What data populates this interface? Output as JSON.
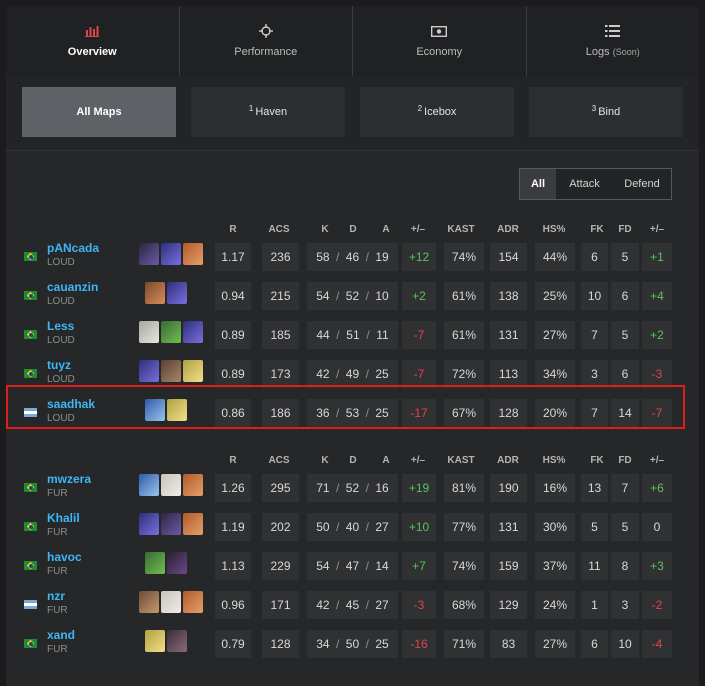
{
  "tabs": [
    {
      "label": "Overview",
      "icon": "bar-chart-icon",
      "active": true
    },
    {
      "label": "Performance",
      "icon": "crosshair-icon",
      "active": false
    },
    {
      "label": "Economy",
      "icon": "money-icon",
      "active": false
    },
    {
      "label": "Logs",
      "suffix": "(Soon)",
      "icon": "list-icon",
      "active": false
    }
  ],
  "maps": [
    {
      "num": "",
      "label": "All Maps",
      "active": true
    },
    {
      "num": "1",
      "label": "Haven"
    },
    {
      "num": "2",
      "label": "Icebox"
    },
    {
      "num": "3",
      "label": "Bind"
    }
  ],
  "side_filter": {
    "all": "All",
    "attack": "Attack",
    "defend": "Defend",
    "selected": "All"
  },
  "headers": {
    "r": "R",
    "acs": "ACS",
    "k": "K",
    "d": "D",
    "a": "A",
    "pm": "+/–",
    "kast": "KAST",
    "adr": "ADR",
    "hs": "HS%",
    "fk": "FK",
    "fd": "FD",
    "fkpm": "+/–"
  },
  "colors": {
    "accent_tab_icon": "#e0454b",
    "positive": "#5dc15d",
    "negative": "#e0454b",
    "player_link": "#3fb6f5",
    "highlight": "#e21b1b"
  },
  "teams": [
    {
      "players": [
        {
          "name": "pANcada",
          "team": "LOUD",
          "flag": "br",
          "agents": [
            "omen",
            "astra",
            "kayo"
          ],
          "r": "1.17",
          "acs": "236",
          "k": "58",
          "d": "46",
          "a": "19",
          "pm": "+12",
          "kast": "74%",
          "adr": "154",
          "hs": "44%",
          "fk": "6",
          "fd": "5",
          "fkpm": "+1"
        },
        {
          "name": "cauanzin",
          "team": "LOUD",
          "flag": "br",
          "agents": [
            "skye",
            "astra"
          ],
          "r": "0.94",
          "acs": "215",
          "k": "54",
          "d": "52",
          "a": "10",
          "pm": "+2",
          "kast": "61%",
          "adr": "138",
          "hs": "25%",
          "fk": "10",
          "fd": "6",
          "fkpm": "+4"
        },
        {
          "name": "Less",
          "team": "LOUD",
          "flag": "br",
          "agents": [
            "sage",
            "viper",
            "astra"
          ],
          "r": "0.89",
          "acs": "185",
          "k": "44",
          "d": "51",
          "a": "11",
          "pm": "-7",
          "kast": "61%",
          "adr": "131",
          "hs": "27%",
          "fk": "7",
          "fd": "5",
          "fkpm": "+2"
        },
        {
          "name": "tuyz",
          "team": "LOUD",
          "flag": "br",
          "agents": [
            "astra",
            "brimstone",
            "neon"
          ],
          "r": "0.89",
          "acs": "173",
          "k": "42",
          "d": "49",
          "a": "25",
          "pm": "-7",
          "kast": "72%",
          "adr": "113",
          "hs": "34%",
          "fk": "3",
          "fd": "6",
          "fkpm": "-3"
        },
        {
          "name": "saadhak",
          "team": "LOUD",
          "flag": "ar",
          "agents": [
            "jett",
            "neon"
          ],
          "r": "0.86",
          "acs": "186",
          "k": "36",
          "d": "53",
          "a": "25",
          "pm": "-17",
          "kast": "67%",
          "adr": "128",
          "hs": "20%",
          "fk": "7",
          "fd": "14",
          "fkpm": "-7"
        }
      ]
    },
    {
      "players": [
        {
          "name": "mwzera",
          "team": "FUR",
          "flag": "br",
          "agents": [
            "jett",
            "chamber",
            "kayo"
          ],
          "r": "1.26",
          "acs": "295",
          "k": "71",
          "d": "52",
          "a": "16",
          "pm": "+19",
          "kast": "81%",
          "adr": "190",
          "hs": "16%",
          "fk": "13",
          "fd": "7",
          "fkpm": "+6"
        },
        {
          "name": "Khalil",
          "team": "FUR",
          "flag": "br",
          "agents": [
            "astra",
            "omen",
            "kayo"
          ],
          "r": "1.19",
          "acs": "202",
          "k": "50",
          "d": "40",
          "a": "27",
          "pm": "+10",
          "kast": "77%",
          "adr": "131",
          "hs": "30%",
          "fk": "5",
          "fd": "5",
          "fkpm": "0"
        },
        {
          "name": "havoc",
          "team": "FUR",
          "flag": "br",
          "agents": [
            "viper",
            "reyna"
          ],
          "r": "1.13",
          "acs": "229",
          "k": "54",
          "d": "47",
          "a": "14",
          "pm": "+7",
          "kast": "74%",
          "adr": "159",
          "hs": "37%",
          "fk": "11",
          "fd": "8",
          "fkpm": "+3"
        },
        {
          "name": "nzr",
          "team": "FUR",
          "flag": "ar",
          "agents": [
            "sova",
            "chamber",
            "kayo"
          ],
          "r": "0.96",
          "acs": "171",
          "k": "42",
          "d": "45",
          "a": "27",
          "pm": "-3",
          "kast": "68%",
          "adr": "129",
          "hs": "24%",
          "fk": "1",
          "fd": "3",
          "fkpm": "-2"
        },
        {
          "name": "xand",
          "team": "FUR",
          "flag": "br",
          "agents": [
            "neon",
            "fade"
          ],
          "r": "0.79",
          "acs": "128",
          "k": "34",
          "d": "50",
          "a": "25",
          "pm": "-16",
          "kast": "71%",
          "adr": "83",
          "hs": "27%",
          "fk": "6",
          "fd": "10",
          "fkpm": "-4"
        }
      ]
    }
  ]
}
